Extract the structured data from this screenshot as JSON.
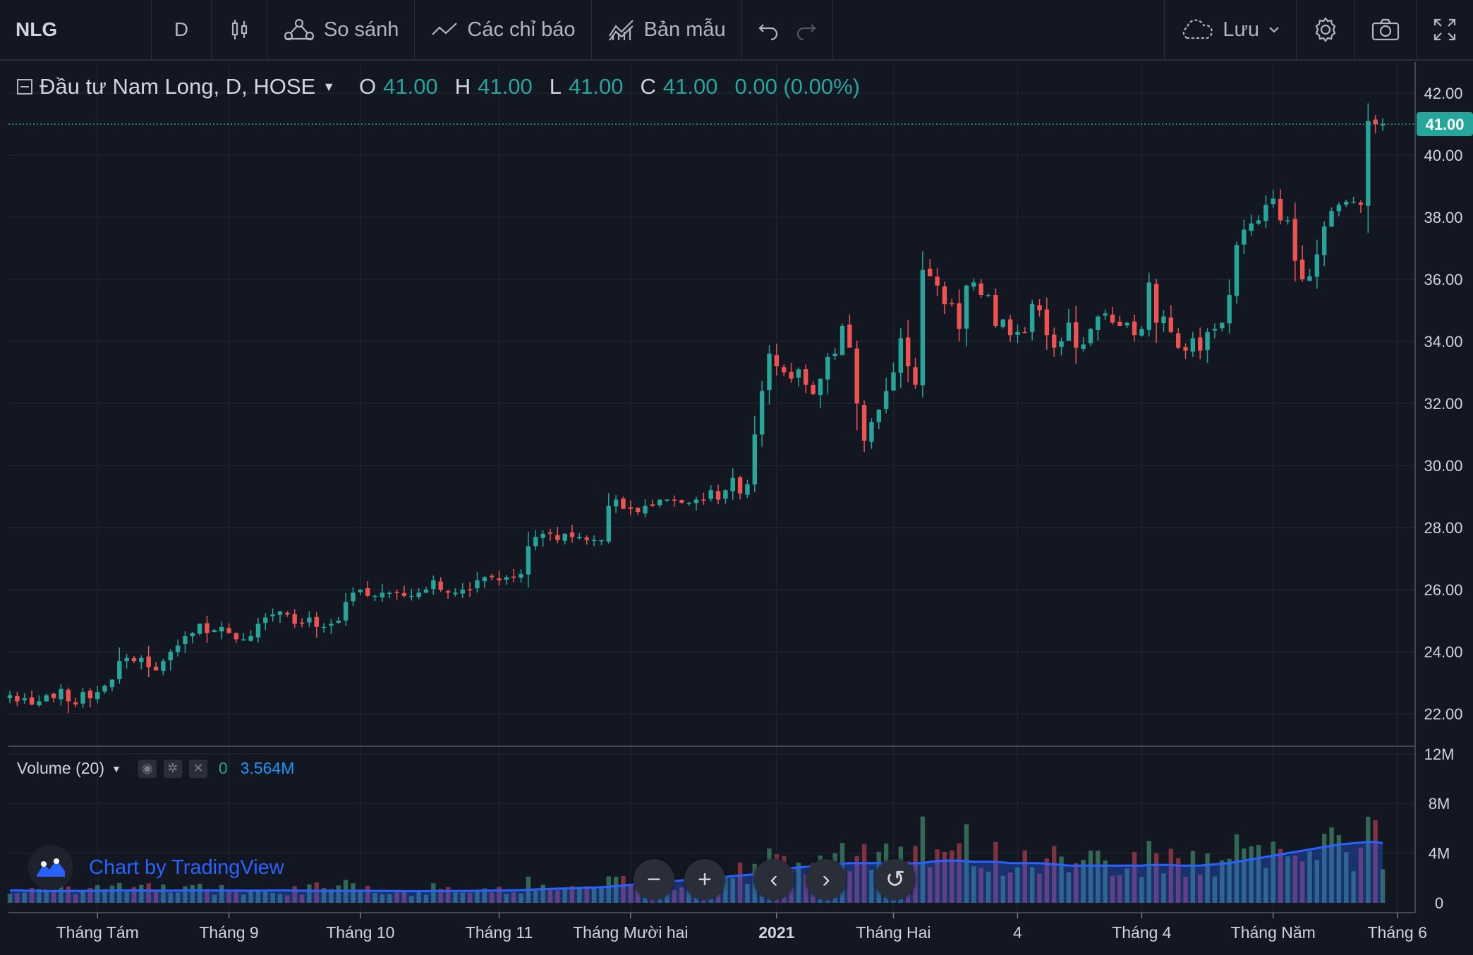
{
  "toolbar": {
    "symbol": "NLG",
    "interval": "D",
    "compare_label": "So sánh",
    "indicators_label": "Các chỉ báo",
    "templates_label": "Bản mẫu",
    "save_label": "Lưu"
  },
  "legend": {
    "title": "Đầu tư Nam Long, D, HOSE",
    "o_key": "O",
    "o_val": "41.00",
    "h_key": "H",
    "h_val": "41.00",
    "l_key": "L",
    "l_val": "41.00",
    "c_key": "C",
    "c_val": "41.00",
    "change": "0.00 (0.00%)"
  },
  "volume_legend": {
    "label": "Volume (20)",
    "value": "0",
    "ma_value": "3.564M"
  },
  "watermark": "Chart by TradingView",
  "colors": {
    "background": "#131722",
    "up": "#26a69a",
    "down": "#ef5350",
    "up_vol": "#336854",
    "down_vol": "#7f323f",
    "volume_ma": "#2962ff",
    "grid": "#1f2330",
    "last_price": "#26a69a"
  },
  "chart_data": {
    "type": "candlestick",
    "symbol": "NLG",
    "last_price": 41.0,
    "price_axis": {
      "range": [
        21.0,
        43.0
      ],
      "ticks": [
        "42.00",
        "40.00",
        "38.00",
        "36.00",
        "34.00",
        "32.00",
        "30.00",
        "28.00",
        "26.00",
        "24.00",
        "22.00"
      ],
      "last_label": "41.00"
    },
    "volume_axis": {
      "range": [
        0,
        12.5
      ],
      "ticks": [
        "12M",
        "8M",
        "4M",
        "0"
      ]
    },
    "time_axis": [
      "Tháng Tám",
      "Tháng 9",
      "Tháng 10",
      "Tháng 11",
      "Tháng Mười hai",
      "2021",
      "Tháng Hai",
      "4",
      "Tháng 4",
      "Tháng Năm",
      "Tháng 6"
    ],
    "closes": [
      22.6,
      22.4,
      22.5,
      22.3,
      22.4,
      22.6,
      22.5,
      22.8,
      22.4,
      22.3,
      22.7,
      22.5,
      22.7,
      22.9,
      23.1,
      23.7,
      23.8,
      23.7,
      23.8,
      23.5,
      23.4,
      23.7,
      24.0,
      24.2,
      24.5,
      24.6,
      24.9,
      24.6,
      24.7,
      24.8,
      24.6,
      24.4,
      24.4,
      24.5,
      24.9,
      25.1,
      25.2,
      25.3,
      25.2,
      24.9,
      24.9,
      25.1,
      24.8,
      24.8,
      24.9,
      25.0,
      25.6,
      25.9,
      26.0,
      25.8,
      25.8,
      25.9,
      25.9,
      25.9,
      25.8,
      25.8,
      25.9,
      26.0,
      26.3,
      26.0,
      25.9,
      25.9,
      26.0,
      26.0,
      26.3,
      26.4,
      26.4,
      26.3,
      26.4,
      26.4,
      26.5,
      27.4,
      27.7,
      27.8,
      27.8,
      27.6,
      27.8,
      27.7,
      27.7,
      27.6,
      27.6,
      27.6,
      28.7,
      28.9,
      28.6,
      28.6,
      28.5,
      28.7,
      28.7,
      28.9,
      28.9,
      28.9,
      28.8,
      28.8,
      28.9,
      28.9,
      29.2,
      28.9,
      29.2,
      29.6,
      29.1,
      29.4,
      31.0,
      32.4,
      33.6,
      33.2,
      33.0,
      32.8,
      33.1,
      32.6,
      32.3,
      32.8,
      33.5,
      33.6,
      34.5,
      33.8,
      32.0,
      30.8,
      31.4,
      31.8,
      32.4,
      33.0,
      34.1,
      33.2,
      32.6,
      36.3,
      36.1,
      35.8,
      35.2,
      35.2,
      34.4,
      35.8,
      35.9,
      35.5,
      35.5,
      34.5,
      34.7,
      34.2,
      34.3,
      34.3,
      35.2,
      35.0,
      34.2,
      33.8,
      34.0,
      34.6,
      33.8,
      33.9,
      34.4,
      34.8,
      34.9,
      34.6,
      34.5,
      34.6,
      34.2,
      34.4,
      35.9,
      34.6,
      34.8,
      34.3,
      33.8,
      33.7,
      34.1,
      33.7,
      34.3,
      34.4,
      34.6,
      35.5,
      37.1,
      37.6,
      37.8,
      37.9,
      38.4,
      38.6,
      37.9,
      37.9,
      36.6,
      36.0,
      36.1,
      36.8,
      37.7,
      38.2,
      38.4,
      38.5,
      38.5,
      38.4,
      41.1,
      41.0,
      41.0
    ],
    "volume_ma": [
      1.0,
      1.0,
      0.98,
      0.97,
      0.96,
      0.96,
      0.95,
      0.95,
      0.95,
      0.96,
      0.96,
      0.97,
      0.97,
      0.98,
      0.99,
      1.0,
      1.0,
      1.0,
      1.0,
      0.99,
      0.98,
      0.98,
      0.98,
      0.99,
      1.0,
      1.0,
      1.01,
      1.0,
      1.0,
      1.0,
      0.99,
      0.99,
      0.98,
      0.98,
      0.99,
      0.99,
      1.0,
      1.0,
      1.0,
      0.99,
      0.98,
      0.98,
      0.97,
      0.97,
      0.96,
      0.96,
      0.96,
      0.97,
      0.97,
      0.97,
      0.96,
      0.96,
      0.95,
      0.95,
      0.94,
      0.94,
      0.94,
      0.94,
      0.95,
      0.95,
      0.95,
      0.95,
      0.96,
      0.96,
      0.97,
      0.98,
      0.99,
      1.0,
      1.0,
      1.01,
      1.02,
      1.05,
      1.08,
      1.1,
      1.12,
      1.14,
      1.16,
      1.18,
      1.2,
      1.22,
      1.24,
      1.26,
      1.3,
      1.35,
      1.4,
      1.45,
      1.5,
      1.55,
      1.6,
      1.65,
      1.7,
      1.75,
      1.8,
      1.85,
      1.9,
      1.95,
      2.0,
      2.05,
      2.1,
      2.15,
      2.2,
      2.25,
      2.3,
      2.4,
      2.5,
      2.6,
      2.7,
      2.8,
      2.85,
      2.9,
      2.95,
      3.0,
      3.05,
      3.1,
      3.15,
      3.2,
      3.2,
      3.2,
      3.2,
      3.2,
      3.15,
      3.1,
      3.1,
      3.15,
      3.2,
      3.2,
      3.3,
      3.35,
      3.4,
      3.4,
      3.4,
      3.35,
      3.3,
      3.3,
      3.3,
      3.3,
      3.25,
      3.2,
      3.2,
      3.2,
      3.2,
      3.2,
      3.15,
      3.1,
      3.05,
      3.0,
      3.0,
      3.0,
      3.0,
      3.0,
      3.0,
      3.0,
      3.0,
      3.0,
      3.0,
      3.0,
      3.05,
      3.05,
      3.05,
      3.05,
      3.0,
      3.0,
      3.0,
      3.0,
      3.05,
      3.1,
      3.15,
      3.2,
      3.3,
      3.4,
      3.5,
      3.6,
      3.7,
      3.8,
      3.9,
      4.0,
      4.1,
      4.2,
      4.3,
      4.4,
      4.5,
      4.6,
      4.7,
      4.75,
      4.8,
      4.85,
      4.9,
      4.9,
      4.8
    ]
  }
}
